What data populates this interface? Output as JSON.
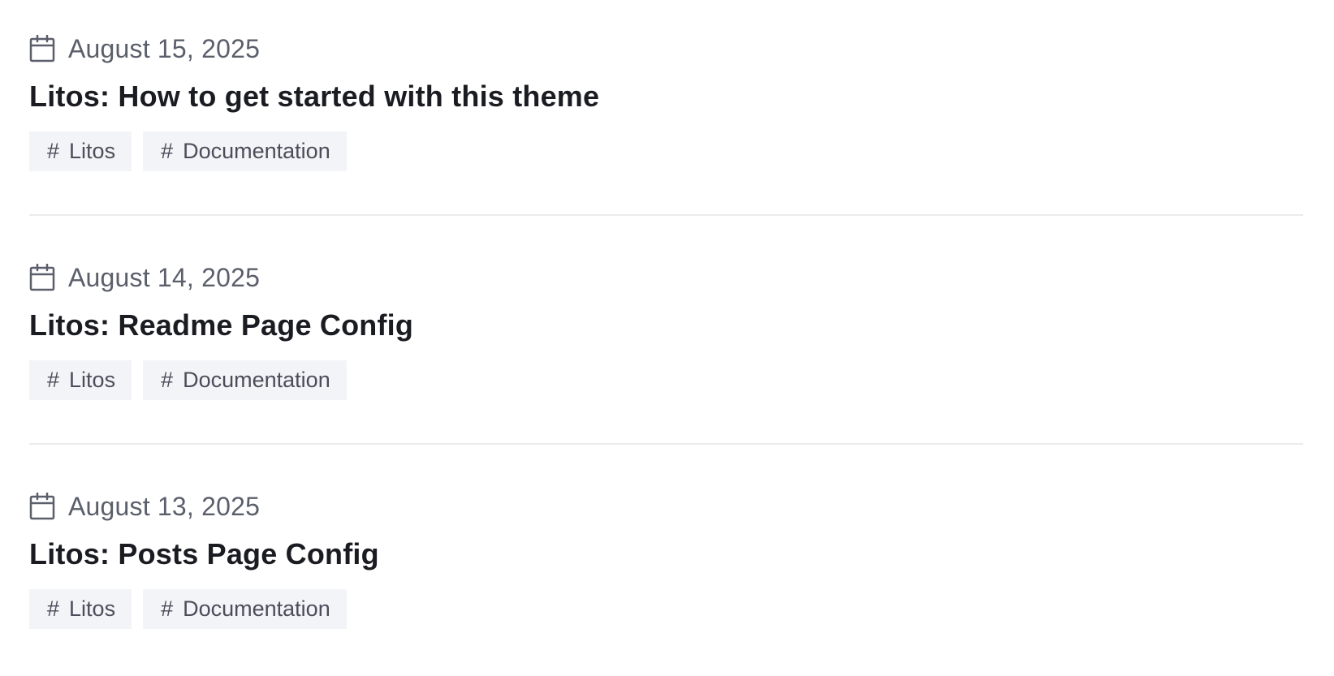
{
  "posts": [
    {
      "date": "August 15, 2025",
      "title": "Litos: How to get started with this theme",
      "tags": [
        {
          "hash": "#",
          "label": "Litos"
        },
        {
          "hash": "#",
          "label": "Documentation"
        }
      ]
    },
    {
      "date": "August 14, 2025",
      "title": "Litos: Readme Page Config",
      "tags": [
        {
          "hash": "#",
          "label": "Litos"
        },
        {
          "hash": "#",
          "label": "Documentation"
        }
      ]
    },
    {
      "date": "August 13, 2025",
      "title": "Litos: Posts Page Config",
      "tags": [
        {
          "hash": "#",
          "label": "Litos"
        },
        {
          "hash": "#",
          "label": "Documentation"
        }
      ]
    }
  ],
  "icons": {
    "date": "calendar-icon"
  },
  "colors": {
    "title": "#1b1c22",
    "date": "#5b5f6b",
    "tag_bg": "#f3f4f7",
    "tag_text": "#4a4e5a",
    "divider": "#ececef"
  }
}
